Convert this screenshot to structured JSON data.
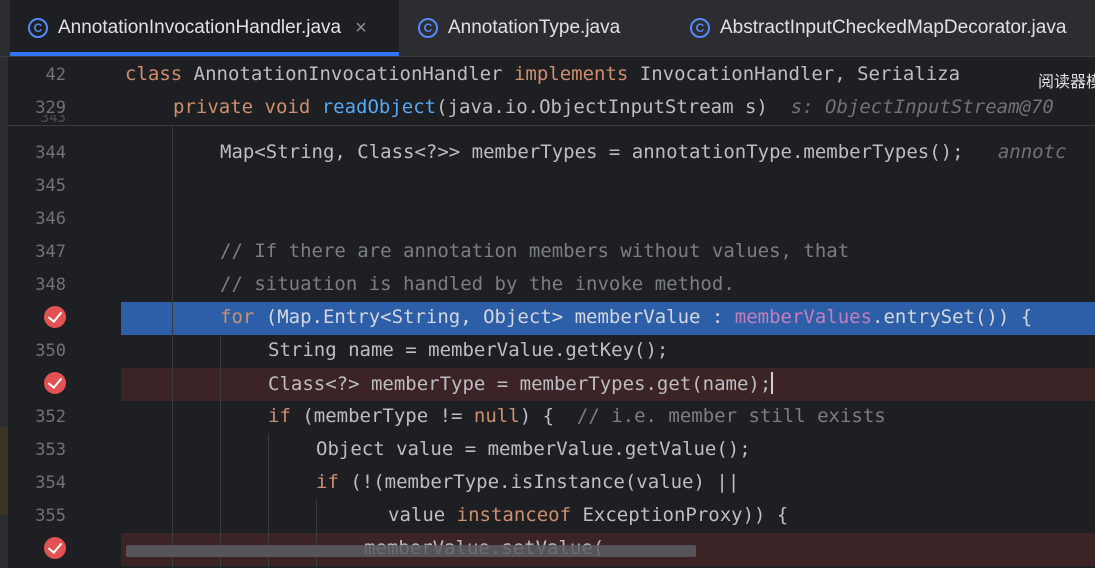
{
  "tabs": [
    {
      "label": "AnnotationInvocationHandler.java",
      "active": true,
      "close": "×"
    },
    {
      "label": "AnnotationType.java",
      "active": false
    },
    {
      "label": "AbstractInputCheckedMapDecorator.java",
      "active": false
    }
  ],
  "tab_icon_letter": "C",
  "sticky": {
    "lines": [
      {
        "num": "42",
        "parts": [
          "class",
          " AnnotationInvocationHandler ",
          "implements",
          " InvocationHandler, Serializa"
        ]
      },
      {
        "num": "329",
        "parts": [
          "private void",
          " ",
          "readObject",
          "(java.io.ObjectInputStream s)",
          "  s: ObjectInputStream@70"
        ]
      }
    ],
    "partial_line_number": "343"
  },
  "overlay_text": "阅读器模",
  "lines": [
    {
      "num": "344",
      "parts": [
        "Map<String, Class<?>> memberTypes = annotationType.memberTypes();",
        "   annotc"
      ]
    },
    {
      "num": "345",
      "parts": []
    },
    {
      "num": "346",
      "parts": []
    },
    {
      "num": "347",
      "parts": [
        "// If there are annotation members without values, that"
      ]
    },
    {
      "num": "348",
      "parts": [
        "// situation is handled by the invoke method."
      ]
    },
    {
      "num": "",
      "breakpoint": true,
      "parts": [
        "for",
        " (Map.Entry<String, Object> memberValue : ",
        "memberValues",
        ".entrySet()) {"
      ]
    },
    {
      "num": "350",
      "parts": [
        "String name = memberValue.getKey();"
      ]
    },
    {
      "num": "",
      "breakpoint": true,
      "parts": [
        "Class<?> memberType = memberTypes.get(name);"
      ]
    },
    {
      "num": "352",
      "parts": [
        "if",
        " (memberType != ",
        "null",
        ") {  ",
        "// i.e. member still exists"
      ]
    },
    {
      "num": "353",
      "parts": [
        "Object value = memberValue.getValue();"
      ]
    },
    {
      "num": "354",
      "parts": [
        "if",
        " (!(memberType.isInstance(value) ||"
      ]
    },
    {
      "num": "355",
      "parts": [
        "value ",
        "instanceof",
        " ExceptionProxy)) {"
      ]
    },
    {
      "num": "",
      "breakpoint": true,
      "parts": [
        "memberValue.setValue("
      ]
    }
  ],
  "colors": {
    "background": "#1e1f22",
    "keyword": "#cf8e6d",
    "method": "#56a8f5",
    "comment": "#7a7e85",
    "field": "#c77dbb",
    "execution_line": "#2d5fa8",
    "breakpoint_line": "#3c2426",
    "breakpoint": "#e35252"
  },
  "icons": [
    "java-class-icon",
    "close-icon",
    "breakpoint-icon"
  ]
}
